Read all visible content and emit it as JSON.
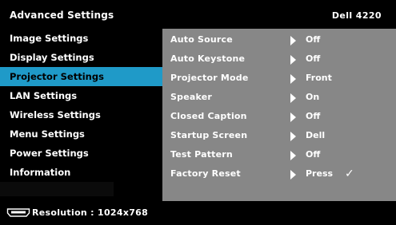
{
  "header": {
    "title": "Advanced Settings",
    "model": "Dell 4220"
  },
  "sidebar": {
    "items": [
      {
        "label": "Image Settings",
        "active": false
      },
      {
        "label": "Display Settings",
        "active": false
      },
      {
        "label": "Projector Settings",
        "active": true
      },
      {
        "label": "LAN Settings",
        "active": false
      },
      {
        "label": "Wireless Settings",
        "active": false
      },
      {
        "label": "Menu Settings",
        "active": false
      },
      {
        "label": "Power Settings",
        "active": false
      },
      {
        "label": "Information",
        "active": false
      }
    ]
  },
  "panel": {
    "rows": [
      {
        "label": "Auto Source",
        "value": "Off"
      },
      {
        "label": "Auto Keystone",
        "value": "Off"
      },
      {
        "label": "Projector Mode",
        "value": "Front"
      },
      {
        "label": "Speaker",
        "value": "On"
      },
      {
        "label": "Closed Caption",
        "value": "Off"
      },
      {
        "label": "Startup Screen",
        "value": "Dell"
      },
      {
        "label": "Test Pattern",
        "value": "Off"
      },
      {
        "label": "Factory Reset",
        "value": "Press",
        "checkmark": "✓"
      }
    ]
  },
  "footer": {
    "input_icon": "hdmi-icon",
    "resolution_text": "Resolution : 1024x768"
  },
  "colors": {
    "background": "#000000",
    "highlight": "#1f9ac8",
    "panel": "#878787",
    "text": "#ffffff"
  }
}
